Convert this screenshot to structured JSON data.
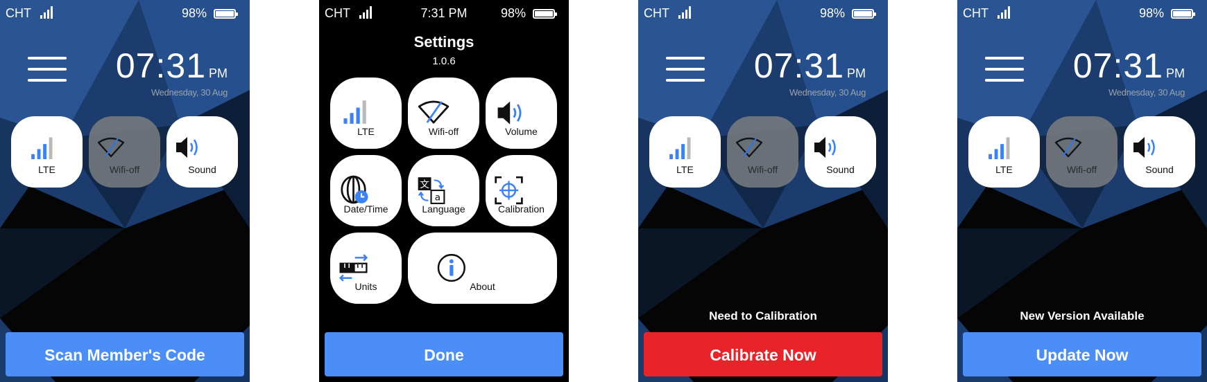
{
  "status": {
    "carrier": "CHT",
    "battery": "98%",
    "time": "7:31 PM"
  },
  "home": {
    "clock_time": "07:31",
    "clock_ampm": "PM",
    "date": "Wednesday, 30 Aug",
    "tiles": [
      {
        "label": "LTE",
        "icon": "signal-icon"
      },
      {
        "label": "Wifi-off",
        "icon": "wifi-off-icon"
      },
      {
        "label": "Sound",
        "icon": "volume-icon"
      }
    ]
  },
  "screen1": {
    "button": "Scan Member's Code"
  },
  "settings": {
    "title": "Settings",
    "version": "1.0.6",
    "tiles": [
      {
        "label": "LTE",
        "icon": "signal-icon"
      },
      {
        "label": "Wifi-off",
        "icon": "wifi-off-icon"
      },
      {
        "label": "Volume",
        "icon": "volume-icon"
      },
      {
        "label": "Date/Time",
        "icon": "globe-clock-icon"
      },
      {
        "label": "Language",
        "icon": "language-icon"
      },
      {
        "label": "Calibration",
        "icon": "crosshair-icon"
      },
      {
        "label": "Units",
        "icon": "ruler-icon"
      },
      {
        "label": "About",
        "icon": "info-icon"
      }
    ],
    "button": "Done"
  },
  "screen3": {
    "notice": "Need to Calibration",
    "button": "Calibrate Now"
  },
  "screen4": {
    "notice": "New Version Available",
    "button": "Update Now"
  },
  "colors": {
    "accent": "#4c8ef7",
    "danger": "#e8242a",
    "icon_blue": "#3b82f6"
  }
}
